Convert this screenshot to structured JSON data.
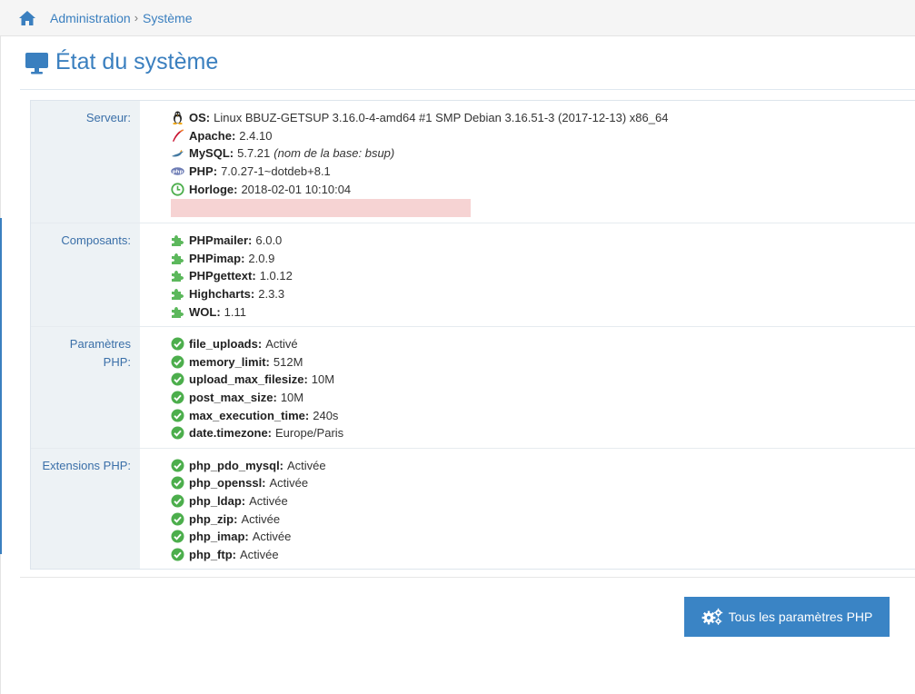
{
  "breadcrumb": {
    "parent": "Administration",
    "separator": "›",
    "current": "Système"
  },
  "page": {
    "title": "État du système"
  },
  "sections": {
    "server": {
      "label": "Serveur:",
      "rows": [
        {
          "icon": "linux-icon",
          "key": "OS:",
          "value": "Linux BBUZ-GETSUP 3.16.0-4-amd64 #1 SMP Debian 3.16.51-3 (2017-12-13) x86_64"
        },
        {
          "icon": "apache-icon",
          "key": "Apache:",
          "value": "2.4.10"
        },
        {
          "icon": "mysql-icon",
          "key": "MySQL:",
          "value": "5.7.21",
          "note": "(nom de la base: bsup)"
        },
        {
          "icon": "php-icon",
          "key": "PHP:",
          "value": "7.0.27-1~dotdeb+8.1"
        },
        {
          "icon": "clock-icon",
          "key": "Horloge:",
          "value": "2018-02-01 10:10:04"
        }
      ]
    },
    "components": {
      "label": "Composants:",
      "rows": [
        {
          "key": "PHPmailer:",
          "value": "6.0.0"
        },
        {
          "key": "PHPimap:",
          "value": "2.0.9"
        },
        {
          "key": "PHPgettext:",
          "value": "1.0.12"
        },
        {
          "key": "Highcharts:",
          "value": "2.3.3"
        },
        {
          "key": "WOL:",
          "value": "1.11"
        }
      ]
    },
    "php_params": {
      "label_line1": "Paramètres",
      "label_line2": "PHP:",
      "rows": [
        {
          "key": "file_uploads:",
          "value": "Activé"
        },
        {
          "key": "memory_limit:",
          "value": "512M"
        },
        {
          "key": "upload_max_filesize:",
          "value": "10M"
        },
        {
          "key": "post_max_size:",
          "value": "10M"
        },
        {
          "key": "max_execution_time:",
          "value": "240s"
        },
        {
          "key": "date.timezone:",
          "value": "Europe/Paris"
        }
      ]
    },
    "php_extensions": {
      "label": "Extensions PHP:",
      "rows": [
        {
          "key": "php_pdo_mysql:",
          "value": "Activée"
        },
        {
          "key": "php_openssl:",
          "value": "Activée"
        },
        {
          "key": "php_ldap:",
          "value": "Activée"
        },
        {
          "key": "php_zip:",
          "value": "Activée"
        },
        {
          "key": "php_imap:",
          "value": "Activée"
        },
        {
          "key": "php_ftp:",
          "value": "Activée"
        }
      ]
    }
  },
  "button": {
    "label": "Tous les paramètres PHP"
  },
  "colors": {
    "accent": "#3a7fbf",
    "button": "#3a84c5",
    "label_bg": "#edf2f5",
    "success": "#4cae4c",
    "component": "#5cb85c",
    "redacted": "#f6d3d3"
  }
}
